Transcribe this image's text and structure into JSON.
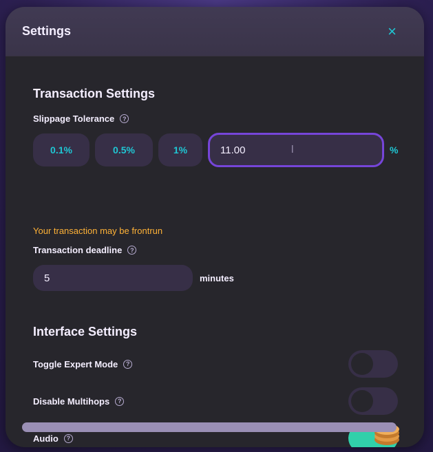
{
  "modal": {
    "title": "Settings",
    "close_glyph": "×"
  },
  "transaction": {
    "section_title": "Transaction Settings",
    "slippage_label": "Slippage Tolerance",
    "slippage_options": [
      "0.1%",
      "0.5%",
      "1%"
    ],
    "slippage_value": "11.00",
    "slippage_unit": "%",
    "warning": "Your transaction may be frontrun",
    "deadline_label": "Transaction deadline",
    "deadline_value": "5",
    "deadline_unit": "minutes"
  },
  "interface": {
    "section_title": "Interface Settings",
    "toggles": [
      {
        "label": "Toggle Expert Mode",
        "on": false
      },
      {
        "label": "Disable Multihops",
        "on": false
      },
      {
        "label": "Audio",
        "on": true
      }
    ]
  },
  "colors": {
    "accent": "#1fc7d4",
    "focus": "#7645d9",
    "warning": "#ffb237",
    "toggle_on": "#31d0aa"
  },
  "icons": {
    "help": "question-circle-icon",
    "close": "close-icon",
    "audio": "pancake-icon"
  }
}
